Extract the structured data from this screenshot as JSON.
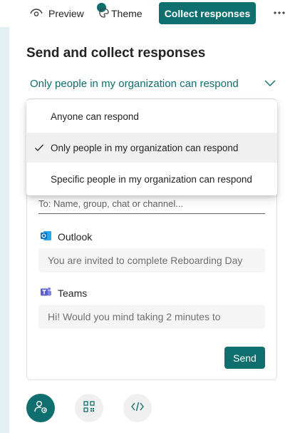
{
  "toolbar": {
    "preview_label": "Preview",
    "theme_label": "Theme",
    "collect_label": "Collect responses",
    "more_icon": "more-horizontal-icon"
  },
  "panel": {
    "title": "Send and collect responses",
    "scope_selected": "Only people in my organization can respond",
    "dropdown_options": [
      {
        "label": "Anyone can respond",
        "selected": false
      },
      {
        "label": "Only people in my organization can respond",
        "selected": true
      },
      {
        "label": "Specific people in my organization can respond",
        "selected": false
      }
    ],
    "to_placeholder": "To: Name, group, chat or channel...",
    "outlook_label": "Outlook",
    "outlook_message": "You are invited to complete Reboarding Day",
    "teams_label": "Teams",
    "teams_message": "Hi! Would you mind taking 2 minutes to",
    "send_label": "Send"
  },
  "colors": {
    "accent": "#0f6e6e",
    "strip": "#e3eff2",
    "outlook": "#0f6cbd",
    "teams": "#5b5fc7"
  }
}
